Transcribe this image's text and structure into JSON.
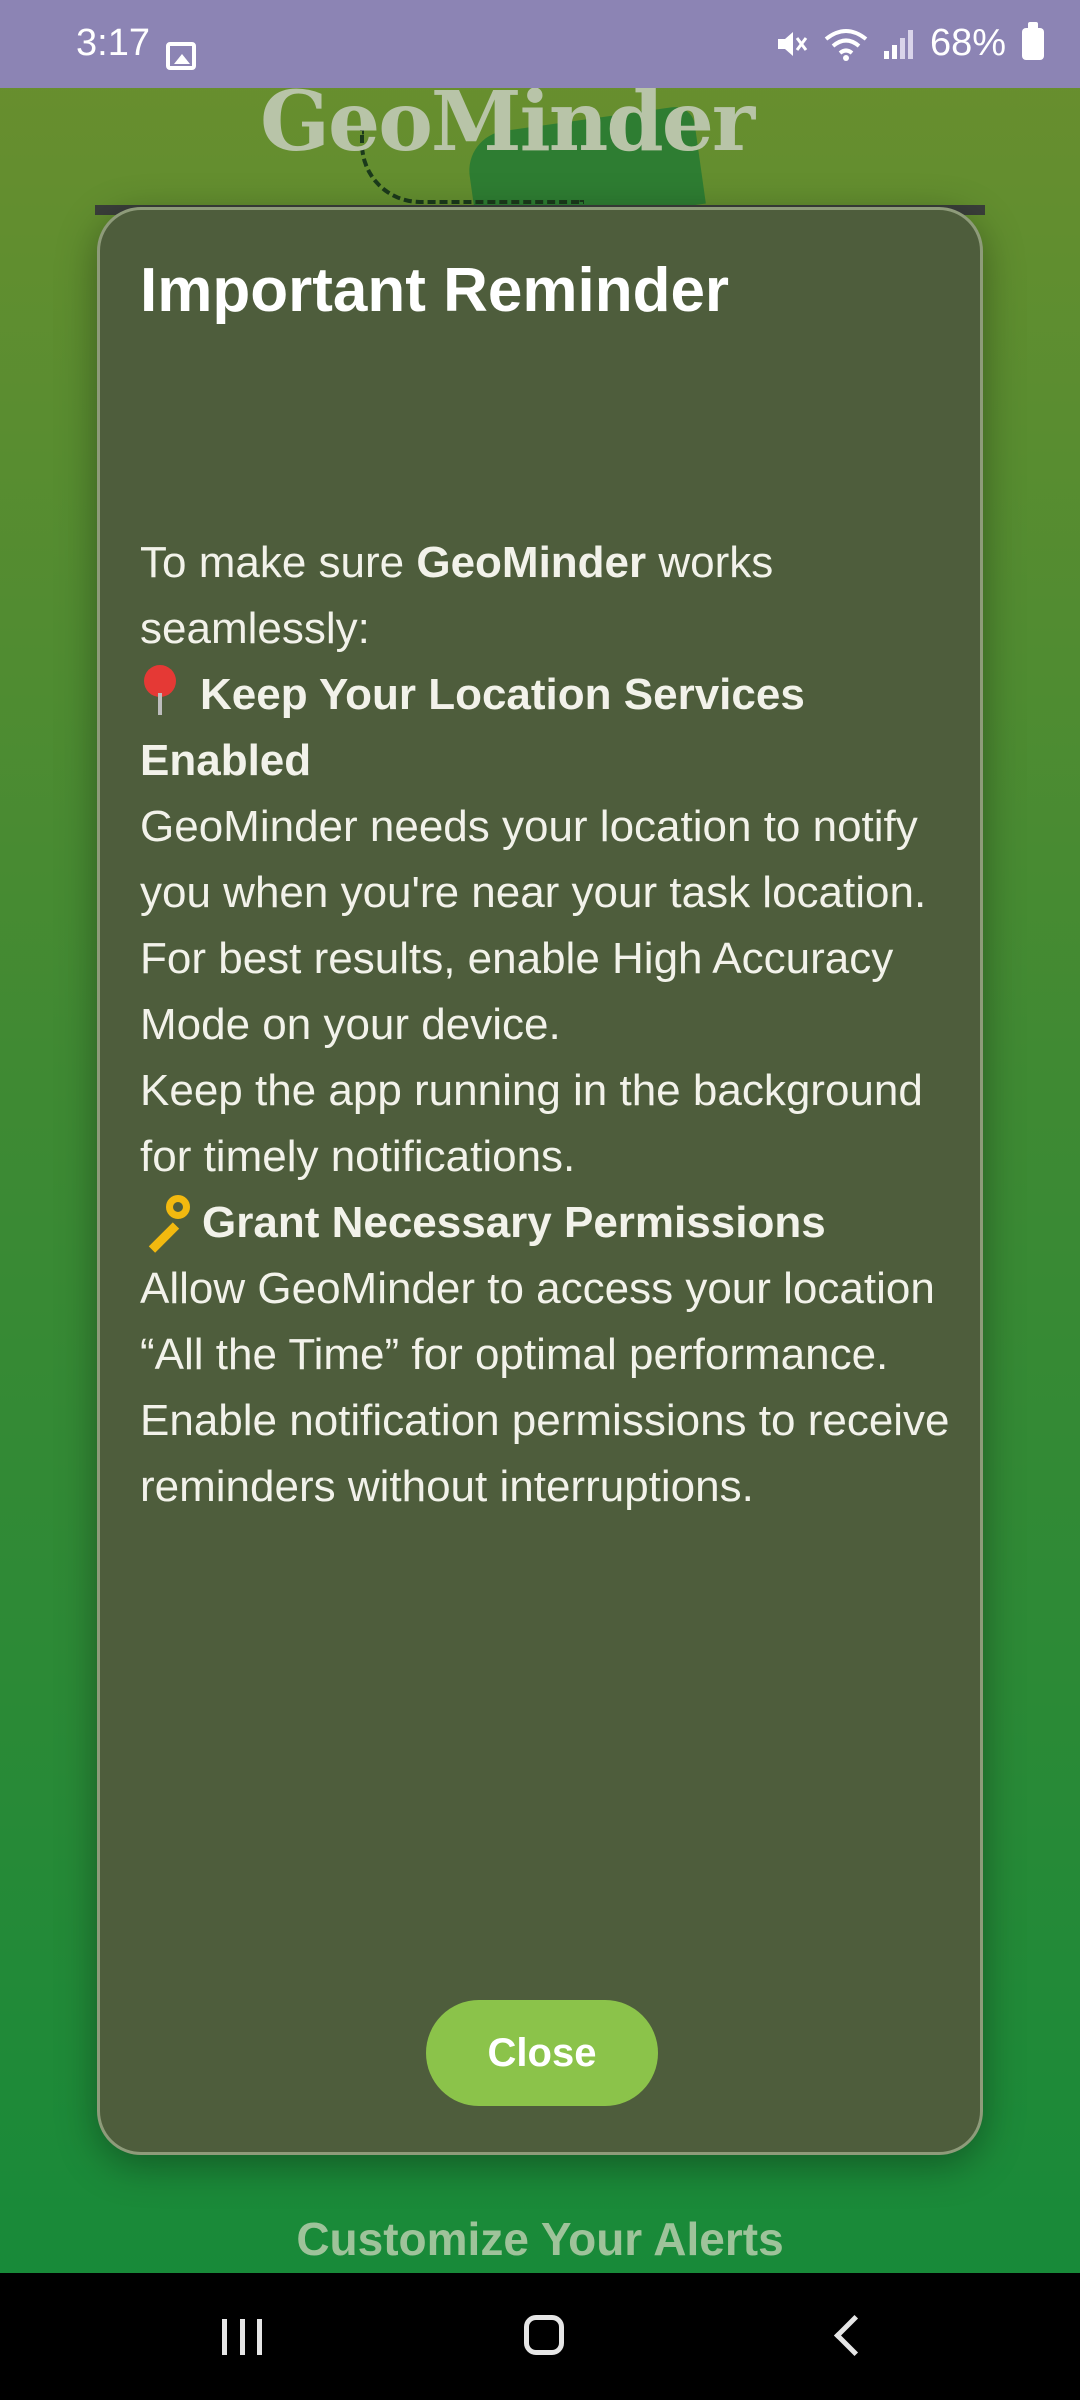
{
  "status_bar": {
    "time": "3:17",
    "battery": "68%",
    "icons": [
      "gallery-icon",
      "mute-icon",
      "wifi-icon",
      "signal-icon",
      "battery-icon"
    ]
  },
  "background": {
    "logo_text": "GeoMinder",
    "section_heading": "Customize Your Alerts"
  },
  "dialog": {
    "title": "Important Reminder",
    "intro_prefix": "To make sure ",
    "intro_app": "GeoMinder",
    "intro_suffix": " works seamlessly:",
    "section1": {
      "icon": "pin-icon",
      "title": "Keep Your Location Services Enabled",
      "lines": [
        "GeoMinder needs your location to notify you when you're near your task location.",
        "For best results, enable High Accuracy Mode on your device.",
        "Keep the app running in the background for timely notifications."
      ]
    },
    "section2": {
      "icon": "key-icon",
      "title": "Grant Necessary Permissions",
      "lines": [
        "Allow GeoMinder to access your location “All the Time” for optimal performance.",
        "Enable notification permissions to receive reminders without interruptions."
      ]
    },
    "close_label": "Close",
    "button_color": "#8bc34a"
  },
  "nav_bar": {
    "icons": [
      "recents-icon",
      "home-icon",
      "back-icon"
    ]
  }
}
